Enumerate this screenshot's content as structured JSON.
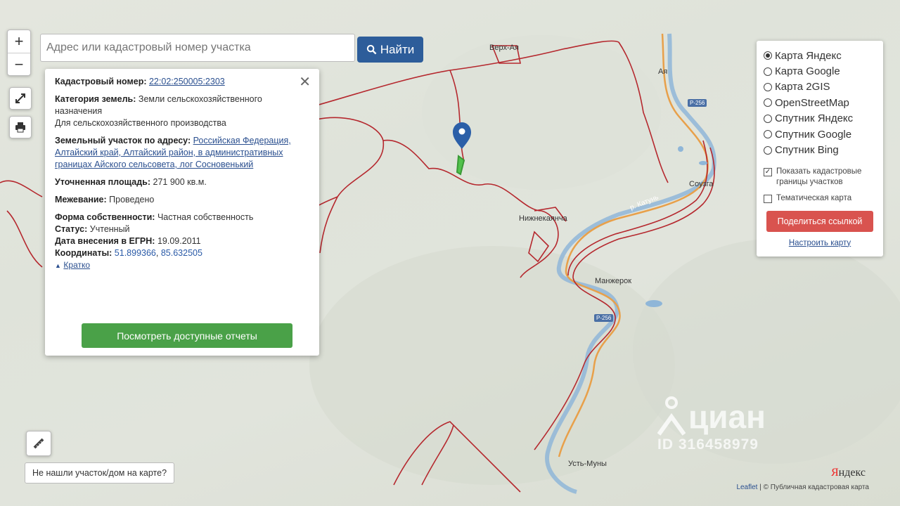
{
  "search": {
    "placeholder": "Адрес или кадастровый номер участка",
    "button_label": "Найти"
  },
  "controls": {
    "zoom_in": "+",
    "zoom_out": "−"
  },
  "popup": {
    "cadastral_label": "Кадастровый номер:",
    "cadastral_value": "22:02:250005:2303",
    "category_label": "Категория земель:",
    "category_value": "Земли сельскохозяйственного назначения",
    "category_use": "Для сельскохозяйственного производства",
    "address_label": "Земельный участок по адресу:",
    "address_value": "Российская Федерация, Алтайский край, Алтайский район, в административных границах Айского сельсовета, лог Сосновенький",
    "area_label": "Уточненная площадь:",
    "area_value": "271 900 кв.м.",
    "survey_label": "Межевание:",
    "survey_value": "Проведено",
    "ownership_label": "Форма собственности:",
    "ownership_value": "Частная собственность",
    "status_label": "Статус:",
    "status_value": "Учтенный",
    "egrn_label": "Дата внесения в ЕГРН:",
    "egrn_value": "19.09.2011",
    "coords_label": "Координаты:",
    "lat": "51.899366",
    "lon": "85.632505",
    "collapse_label": "Кратко",
    "reports_button": "Посмотреть доступные отчеты"
  },
  "layers": {
    "options": [
      "Карта Яндекс",
      "Карта Google",
      "Карта 2GIS",
      "OpenStreetMap",
      "Спутник Яндекс",
      "Спутник Google",
      "Спутник Bing"
    ],
    "selected": "Карта Яндекс",
    "show_borders_label": "Показать кадастровые границы участков",
    "show_borders_checked": true,
    "thematic_label": "Тематическая карта",
    "thematic_checked": false,
    "share_button": "Поделиться ссылкой",
    "customize_link": "Настроить карту"
  },
  "map": {
    "places": [
      "Верх-Ая",
      "Ая",
      "Соузга",
      "Нижнекаянча",
      "Манжерок",
      "Усть-Муны"
    ],
    "roads": [
      "Р-256",
      "Р-256"
    ],
    "river": "р. Катунь"
  },
  "bottom": {
    "not_found_button": "Не нашли участок/дом на карте?",
    "attribution_leaflet": "Leaflet",
    "attribution_rest": "| © Публичная кадастровая карта",
    "yandex_logo_first": "Я",
    "yandex_logo_rest": "ндекс"
  },
  "watermark": {
    "brand": "циан",
    "id": "ID 316458979"
  },
  "colors": {
    "search_button": "#2d5d9a",
    "reports_button": "#4aa148",
    "share_button": "#d9534f",
    "boundary_lines": "#b5282e",
    "river": "#8fb6d8",
    "marker": "#2b5fa8"
  }
}
